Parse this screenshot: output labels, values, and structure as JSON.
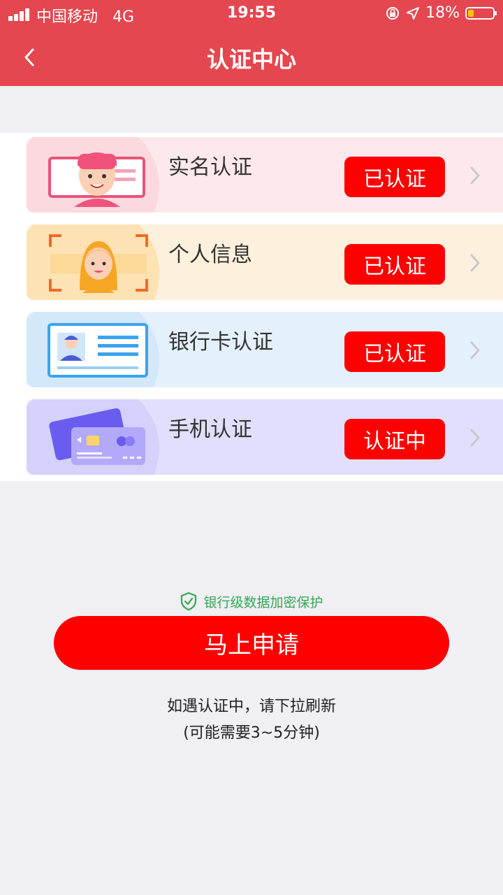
{
  "status_bar": {
    "carrier": "中国移动",
    "network": "4G",
    "time": "19:55",
    "battery_text": "18%",
    "icons": [
      "signal-icon",
      "orientation-lock-icon",
      "location-arrow-icon",
      "battery-icon"
    ]
  },
  "nav": {
    "title": "认证中心",
    "back_icon": "chevron-left-icon"
  },
  "cards": [
    {
      "label": "实名认证",
      "status": "已认证",
      "icon": "id-face-icon",
      "color": "#fde7ea"
    },
    {
      "label": "个人信息",
      "status": "已认证",
      "icon": "face-scan-icon",
      "color": "#fdefd9"
    },
    {
      "label": "银行卡认证",
      "status": "已认证",
      "icon": "id-card-icon",
      "color": "#e3f1fd"
    },
    {
      "label": "手机认证",
      "status": "认证中",
      "icon": "bank-card-icon",
      "color": "#e1dffd"
    }
  ],
  "security_text": "银行级数据加密保护",
  "apply_button": "马上申请",
  "note_line1": "如遇认证中，请下拉刷新",
  "note_line2": "(可能需要3~5分钟)",
  "colors": {
    "header": "#e4474f",
    "accent": "#ff0000",
    "security_green": "#34a853",
    "background": "#efeff4"
  }
}
